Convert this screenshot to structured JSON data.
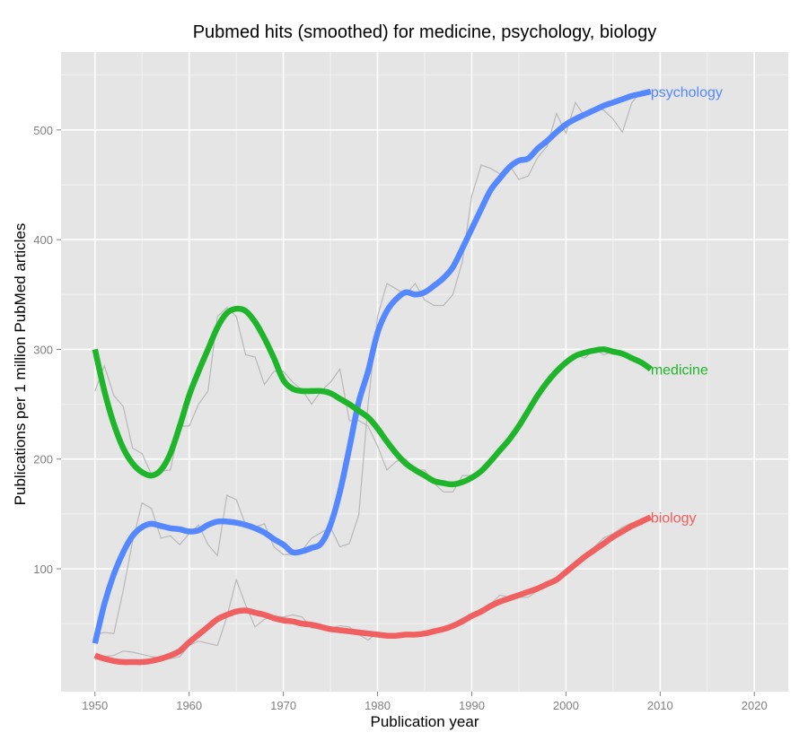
{
  "chart_data": {
    "type": "line",
    "title": "Pubmed hits (smoothed) for medicine, psychology, biology",
    "xlabel": "Publication year",
    "ylabel": "Publications per 1 million PubMed articles",
    "xlim": [
      1946.4,
      2023.6
    ],
    "ylim": [
      -12,
      571
    ],
    "x_ticks": [
      1950,
      1960,
      1970,
      1980,
      1990,
      2000,
      2010,
      2020
    ],
    "x_tick_labels": [
      "1950",
      "1960",
      "1970",
      "1980",
      "1990",
      "2000",
      "2010",
      "2020"
    ],
    "y_ticks": [
      100,
      200,
      300,
      400,
      500
    ],
    "y_tick_labels": [
      "100",
      "200",
      "300",
      "400",
      "500"
    ],
    "grid": true,
    "legend": "direct labels at right end of each line",
    "background": "#e5e5e5",
    "x": [
      1950,
      1951,
      1952,
      1953,
      1954,
      1955,
      1956,
      1957,
      1958,
      1959,
      1960,
      1961,
      1962,
      1963,
      1964,
      1965,
      1966,
      1967,
      1968,
      1969,
      1970,
      1971,
      1972,
      1973,
      1974,
      1975,
      1976,
      1977,
      1978,
      1979,
      1980,
      1981,
      1982,
      1983,
      1984,
      1985,
      1986,
      1987,
      1988,
      1989,
      1990,
      1991,
      1992,
      1993,
      1994,
      1995,
      1996,
      1997,
      1998,
      1999,
      2000,
      2001,
      2002,
      2003,
      2004,
      2005,
      2006,
      2007,
      2008,
      2009
    ],
    "series": [
      {
        "name": "psychology",
        "color": "#5588ff",
        "label": "psychology",
        "values": [
          32,
          68,
          95,
          115,
          130,
          138,
          141,
          139,
          137,
          136,
          134,
          135,
          140,
          143,
          143,
          142,
          140,
          137,
          133,
          127,
          122,
          115,
          116,
          119,
          123,
          140,
          170,
          210,
          252,
          280,
          315,
          335,
          346,
          352,
          350,
          352,
          358,
          365,
          375,
          392,
          410,
          428,
          445,
          456,
          466,
          472,
          474,
          483,
          490,
          498,
          505,
          510,
          514,
          518,
          522,
          525,
          528,
          531,
          533,
          535
        ],
        "raw": [
          40,
          42,
          41,
          80,
          125,
          160,
          155,
          128,
          130,
          122,
          132,
          140,
          122,
          112,
          167,
          163,
          140,
          138,
          141,
          120,
          113,
          113,
          117,
          128,
          133,
          138,
          120,
          123,
          149,
          250,
          330,
          360,
          355,
          350,
          360,
          345,
          340,
          340,
          350,
          380,
          440,
          468,
          465,
          460,
          468,
          455,
          458,
          475,
          485,
          515,
          497,
          525,
          512,
          520,
          518,
          510,
          498,
          525,
          535,
          536
        ]
      },
      {
        "name": "medicine",
        "color": "#1fb52a",
        "label": "medicine",
        "values": [
          300,
          262,
          232,
          210,
          196,
          188,
          185,
          190,
          205,
          230,
          258,
          280,
          300,
          320,
          333,
          337,
          335,
          325,
          310,
          292,
          272,
          264,
          262,
          262,
          262,
          260,
          255,
          250,
          244,
          238,
          228,
          216,
          205,
          196,
          190,
          185,
          180,
          178,
          177,
          179,
          183,
          189,
          198,
          208,
          218,
          230,
          244,
          258,
          270,
          280,
          288,
          294,
          297,
          299,
          300,
          298,
          296,
          292,
          288,
          282
        ],
        "raw": [
          262,
          285,
          258,
          248,
          210,
          205,
          186,
          189,
          190,
          230,
          230,
          250,
          262,
          330,
          338,
          330,
          295,
          293,
          268,
          280,
          280,
          270,
          263,
          250,
          262,
          270,
          282,
          235,
          235,
          230,
          212,
          190,
          198,
          200,
          190,
          190,
          178,
          170,
          170,
          185,
          185,
          190,
          197,
          205,
          215,
          232,
          240,
          258,
          272,
          282,
          290,
          295,
          292,
          300,
          295,
          298,
          296,
          292,
          288,
          285
        ]
      },
      {
        "name": "biology",
        "color": "#f06060",
        "label": "biology",
        "values": [
          21,
          18,
          16,
          15,
          15,
          15,
          16,
          18,
          21,
          25,
          33,
          40,
          47,
          54,
          58,
          61,
          62,
          60,
          58,
          55,
          53,
          52,
          50,
          49,
          47,
          45,
          44,
          43,
          42,
          41,
          40,
          39,
          39,
          40,
          40,
          41,
          43,
          45,
          48,
          52,
          57,
          61,
          66,
          70,
          73,
          76,
          79,
          82,
          86,
          90,
          97,
          104,
          111,
          117,
          123,
          129,
          134,
          139,
          143,
          147
        ],
        "raw": [
          17,
          20,
          21,
          25,
          24,
          22,
          20,
          19,
          18,
          20,
          30,
          34,
          32,
          30,
          56,
          90,
          67,
          47,
          54,
          57,
          56,
          58,
          56,
          46,
          46,
          46,
          48,
          47,
          40,
          35,
          42,
          41,
          40,
          38,
          39,
          40,
          42,
          46,
          50,
          55,
          58,
          62,
          68,
          76,
          74,
          74,
          74,
          80,
          85,
          90,
          98,
          105,
          110,
          120,
          128,
          132,
          138,
          142,
          140,
          146
        ]
      }
    ]
  }
}
